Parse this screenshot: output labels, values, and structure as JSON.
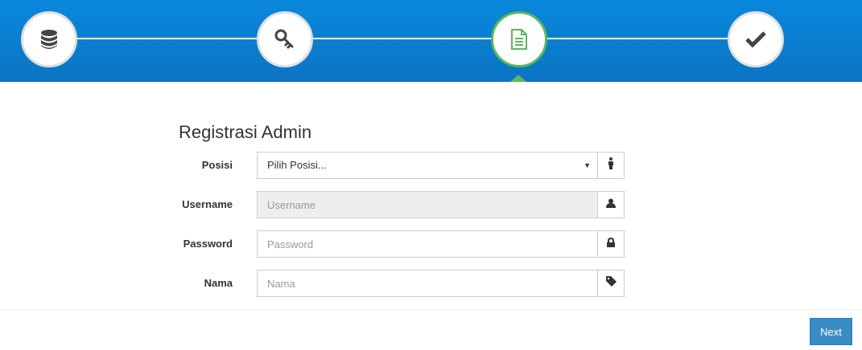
{
  "wizard": {
    "steps": [
      {
        "icon": "database-icon"
      },
      {
        "icon": "key-icon"
      },
      {
        "icon": "document-icon",
        "active": true
      },
      {
        "icon": "checkmark-icon"
      }
    ],
    "colors": {
      "header": "#0a88dc",
      "active_border": "#5cb85c",
      "active_icon": "#5cb85c",
      "inactive_icon": "#444444"
    }
  },
  "form": {
    "title": "Registrasi Admin",
    "posisi": {
      "label": "Posisi",
      "selected": "Pilih Posisi...",
      "addon_icon": "person-icon"
    },
    "username": {
      "label": "Username",
      "placeholder": "Username",
      "addon_icon": "user-icon"
    },
    "password": {
      "label": "Password",
      "placeholder": "Password",
      "addon_icon": "lock-icon"
    },
    "nama": {
      "label": "Nama",
      "placeholder": "Nama",
      "addon_icon": "tag-icon"
    }
  },
  "footer": {
    "next_label": "Next",
    "button_color": "#3a8cc4"
  }
}
